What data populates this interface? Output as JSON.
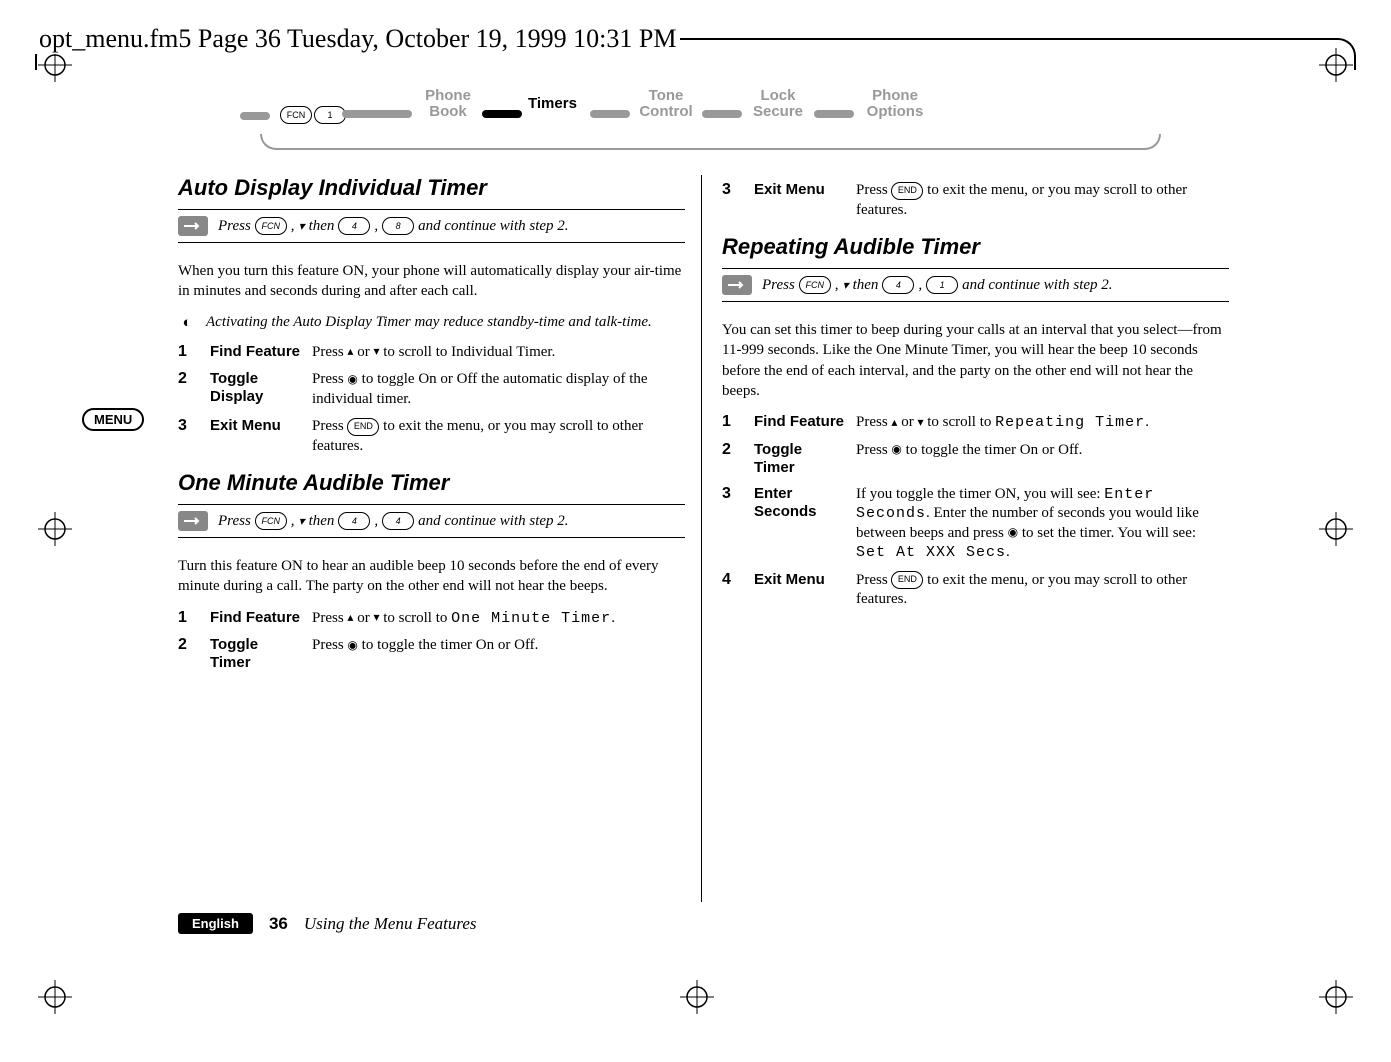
{
  "header_line": "opt_menu.fm5  Page 36  Tuesday, October 19, 1999  10:31 PM",
  "nav": {
    "fcn": "FCN",
    "one": "1",
    "items": [
      "Phone Book",
      "Timers",
      "Tone Control",
      "Lock Secure",
      "Phone Options"
    ],
    "active_index": 1
  },
  "menu_badge": "MENU",
  "left": {
    "s1": {
      "title": "Auto Display Individual Timer",
      "shortcut_pre": "Press ",
      "shortcut_mid1": ", ",
      "shortcut_then": " then ",
      "shortcut_comma": ", ",
      "shortcut_post": " and continue with step 2.",
      "fcn": "FCN",
      "k1": "4",
      "k2": "8",
      "para": "When you turn this feature ON, your phone will automatically display your air-time in minutes and seconds during and after each call.",
      "note": "Activating the Auto Display Timer may reduce standby-time and talk-time.",
      "steps": [
        {
          "n": "1",
          "label": "Find Feature",
          "desc_a": "Press ",
          "desc_b": " or ",
          "desc_c": " to scroll to Individual Timer."
        },
        {
          "n": "2",
          "label": "Toggle Display",
          "desc_a": "Press ",
          "desc_b": " to toggle On or Off the automatic display of the individual timer."
        },
        {
          "n": "3",
          "label": "Exit Menu",
          "desc_a": "Press ",
          "end": "END",
          "desc_b": " to exit the menu, or you may scroll to other features."
        }
      ]
    },
    "s2": {
      "title": "One Minute Audible Timer",
      "shortcut_pre": "Press ",
      "shortcut_then": " then ",
      "shortcut_post": " and continue with step 2.",
      "fcn": "FCN",
      "k1": "4",
      "k2": "4",
      "para": "Turn this feature ON to hear an audible beep 10 seconds before the end of every minute during a call. The party on the other end will not hear the beeps.",
      "steps": [
        {
          "n": "1",
          "label": "Find Feature",
          "desc_a": "Press ",
          "desc_b": " or ",
          "desc_c": " to scroll to ",
          "mono": "One Minute Timer",
          "desc_d": "."
        },
        {
          "n": "2",
          "label": "Toggle Timer",
          "desc_a": "Press ",
          "desc_b": " to toggle the timer On or Off."
        }
      ]
    }
  },
  "right": {
    "top_step": {
      "n": "3",
      "label": "Exit Menu",
      "desc_a": "Press ",
      "end": "END",
      "desc_b": " to exit the menu, or you may scroll to other features."
    },
    "s3": {
      "title": "Repeating Audible Timer",
      "shortcut_pre": "Press ",
      "shortcut_then": " then ",
      "shortcut_post": " and continue with step 2.",
      "fcn": "FCN",
      "k1": "4",
      "k2": "1",
      "para": "You can set this timer to beep during your calls at an interval that you select—from 11-999 seconds. Like the One Minute Timer, you will hear the beep 10 seconds before the end of each interval, and the party on the other end will not hear the beeps.",
      "steps": [
        {
          "n": "1",
          "label": "Find Feature",
          "desc_a": "Press ",
          "desc_b": " or ",
          "desc_c": " to scroll to ",
          "mono": "Repeating Timer",
          "desc_d": "."
        },
        {
          "n": "2",
          "label": "Toggle Timer",
          "desc_a": "Press ",
          "desc_b": " to toggle the timer On or Off."
        },
        {
          "n": "3",
          "label": "Enter Seconds",
          "desc_a": "If you toggle the timer ON, you will see: ",
          "mono1": "Enter Seconds",
          "desc_b": ". Enter the number of seconds you would like between beeps and press ",
          "desc_c": " to set the timer. You will see: ",
          "mono2": "Set At XXX Secs",
          "desc_d": "."
        },
        {
          "n": "4",
          "label": "Exit Menu",
          "desc_a": "Press ",
          "end": "END",
          "desc_b": " to exit the menu, or you may scroll to other features."
        }
      ]
    }
  },
  "footer": {
    "lang": "English",
    "page": "36",
    "title": "Using the Menu Features"
  }
}
